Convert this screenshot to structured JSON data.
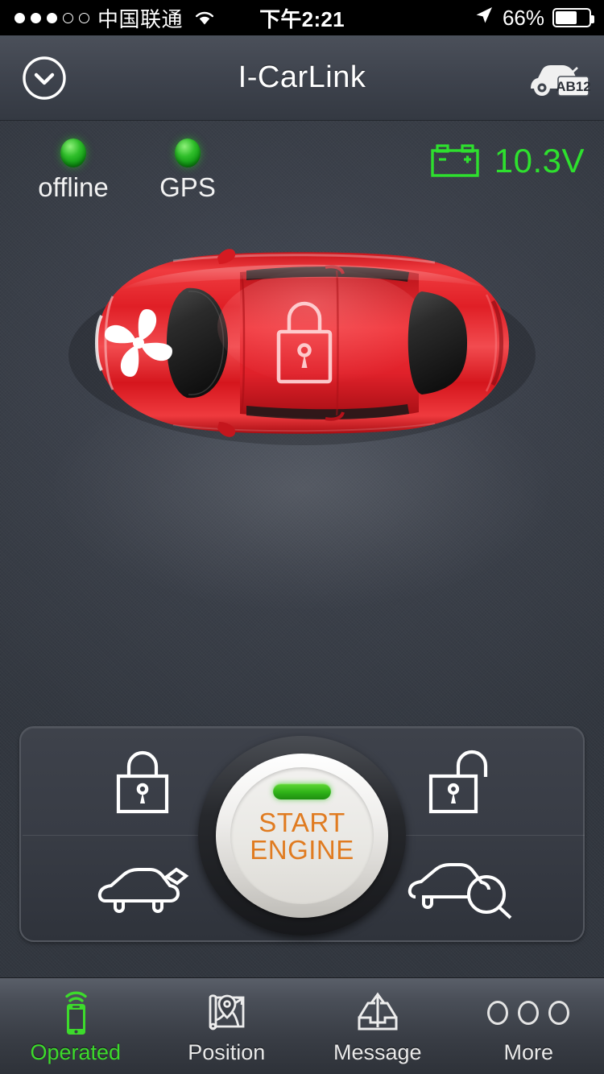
{
  "statusbar": {
    "signal_dots_filled": 3,
    "signal_dots_total": 5,
    "carrier": "中国联通",
    "wifi_icon": "wifi-icon",
    "time": "下午2:21",
    "location_icon": "location-arrow-icon",
    "battery_percent": "66%",
    "battery_level": 66
  },
  "navbar": {
    "back_icon": "chevron-down-circle-icon",
    "title": "I-CarLink",
    "vehicle_icon": "car-plate-icon",
    "vehicle_plate": "AB12"
  },
  "status": {
    "indicators": [
      {
        "label": "offline",
        "led_color": "#2fbe2a",
        "icon": "status-led-icon"
      },
      {
        "label": "GPS",
        "led_color": "#2fbe2a",
        "icon": "status-led-icon"
      }
    ],
    "battery_icon": "car-battery-icon",
    "voltage": "10.3V",
    "voltage_color": "#2ee02e"
  },
  "vehicle": {
    "view": "car-top-view",
    "body_color": "#e01f26",
    "hood_icon": "fan-icon",
    "roof_icon": "lock-icon"
  },
  "controls": {
    "lock_icon": "lock-closed-icon",
    "lock_label": "Lock",
    "unlock_icon": "lock-open-icon",
    "unlock_label": "Unlock",
    "trunk_icon": "car-trunk-open-icon",
    "trunk_label": "Trunk",
    "find_icon": "car-search-icon",
    "find_label": "Find Car",
    "start_button": {
      "icon": "engine-start-icon",
      "led_color": "#2fb318",
      "line1": "START",
      "line2": "ENGINE",
      "text_color": "#e07b20"
    }
  },
  "tabbar": {
    "items": [
      {
        "label": "Operated",
        "icon": "phone-signal-icon",
        "active": true
      },
      {
        "label": "Position",
        "icon": "map-pin-icon",
        "active": false
      },
      {
        "label": "Message",
        "icon": "outbox-tray-icon",
        "active": false
      },
      {
        "label": "More",
        "icon": "three-circles-icon",
        "active": false
      }
    ],
    "active_color": "#3ddb2c"
  }
}
